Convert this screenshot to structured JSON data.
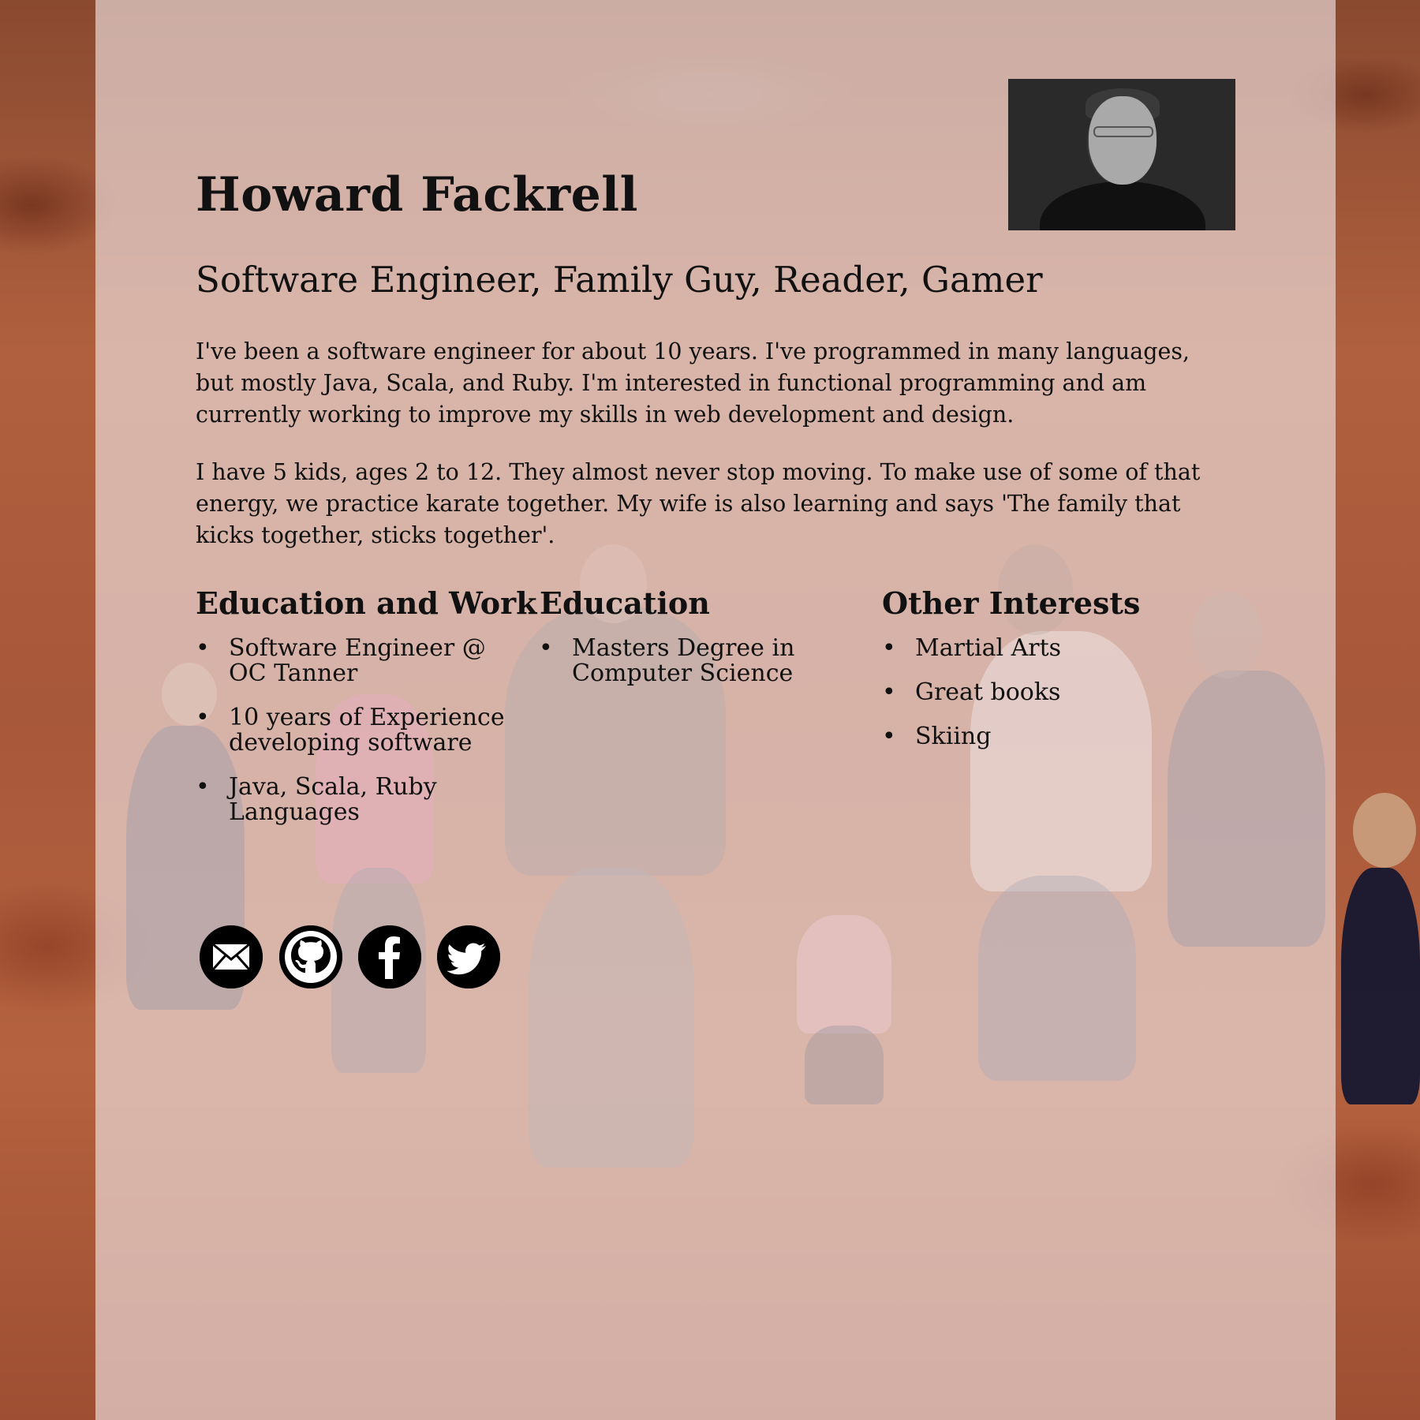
{
  "profile": {
    "name": "Howard Fackrell",
    "tagline": "Software Engineer, Family Guy, Reader, Gamer",
    "bio": [
      "I've been a software engineer for about 10 years. I've programmed in many languages, but mostly Java, Scala, and Ruby. I'm interested in functional programming and am currently working to improve my skills in web development and design.",
      "I have 5 kids, ages 2 to 12. They almost never stop moving. To make use of some of that energy, we practice karate together. My wife is also learning and says 'The family that kicks together, sticks together'."
    ]
  },
  "sections": {
    "work": {
      "title": "Education and Work",
      "items": [
        "Software Engineer @ OC Tanner",
        "10 years of Experience developing software",
        "Java, Scala, Ruby Languages"
      ]
    },
    "education": {
      "title": "Education",
      "items": [
        "Masters Degree in Computer Science"
      ]
    },
    "interests": {
      "title": "Other Interests",
      "items": [
        "Martial Arts",
        "Great books",
        "Skiing"
      ]
    }
  },
  "social": {
    "icons": [
      "envelope-icon",
      "github-icon",
      "facebook-icon",
      "twitter-icon"
    ]
  },
  "colors": {
    "panel_overlay": "#eee0e0",
    "text": "#111111",
    "icon_fill": "#000000",
    "background_rock": "#b0603e"
  }
}
